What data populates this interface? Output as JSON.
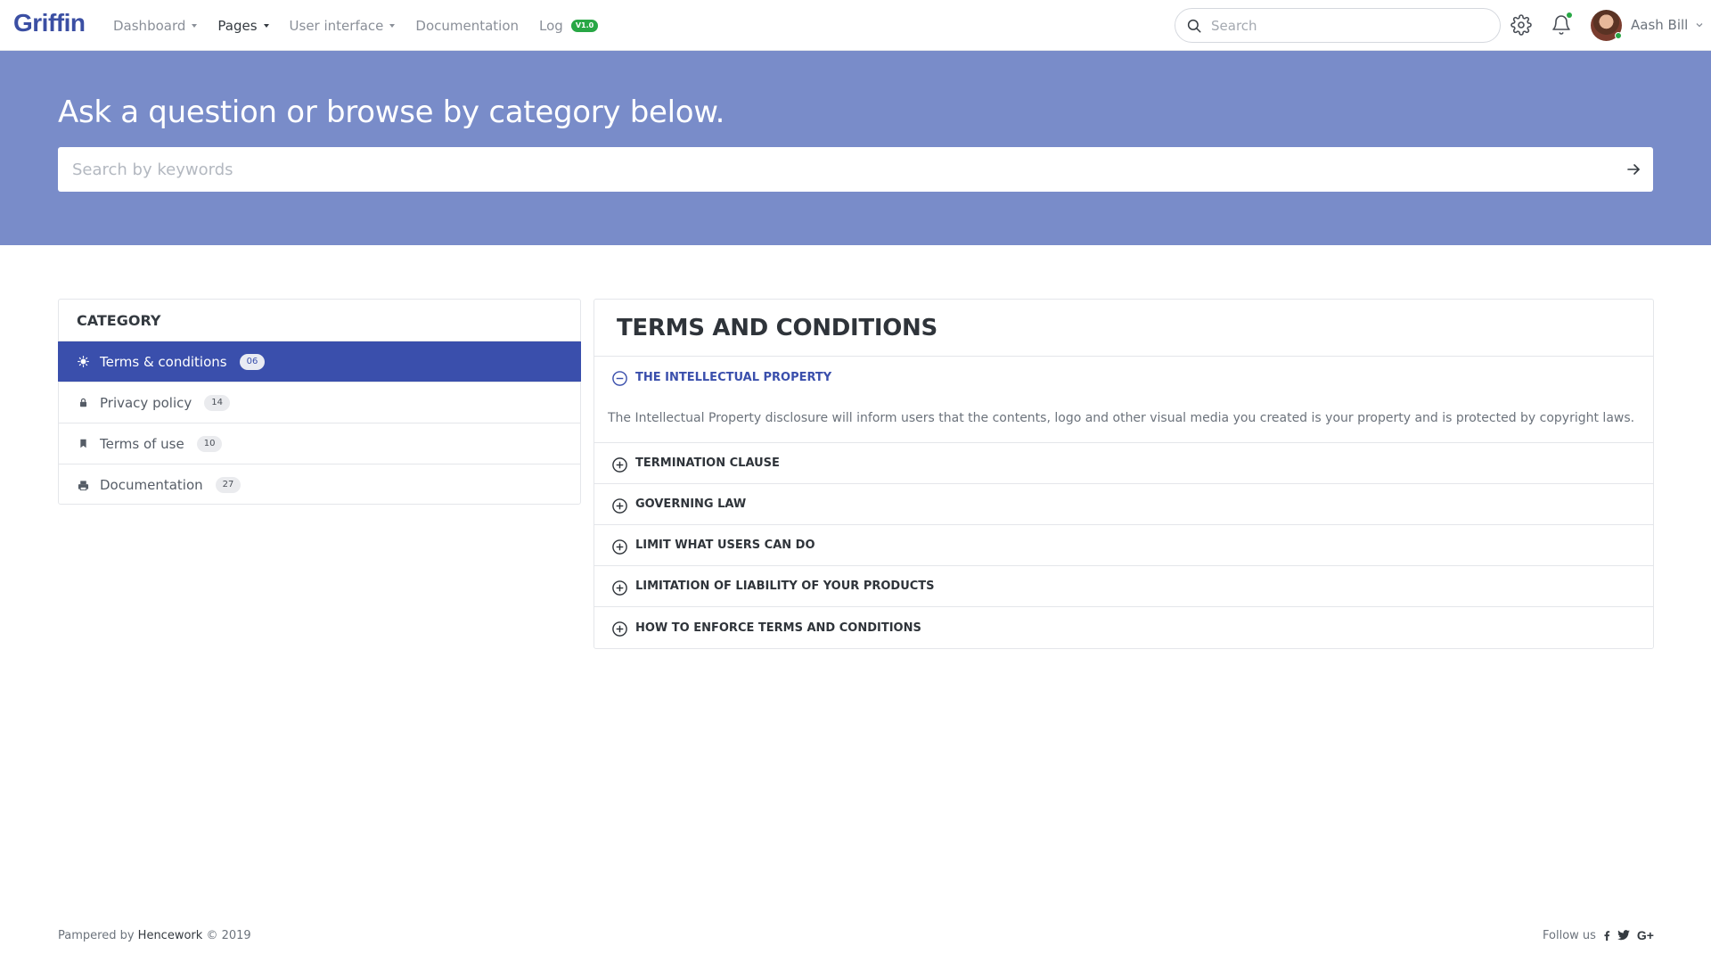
{
  "nav": {
    "brand": "Griffin",
    "items": [
      {
        "label": "Dashboard",
        "has_caret": true
      },
      {
        "label": "Pages",
        "has_caret": true
      },
      {
        "label": "User interface",
        "has_caret": true
      },
      {
        "label": "Documentation",
        "has_caret": false
      },
      {
        "label": "Log",
        "has_caret": false
      }
    ],
    "log_badge": "V1.0",
    "search_placeholder": "Search",
    "user_name": "Aash Bill"
  },
  "hero": {
    "title": "Ask a question or browse by category below.",
    "search_placeholder": "Search by keywords"
  },
  "category": {
    "heading": "CATEGORY",
    "items": [
      {
        "label": "Terms & conditions",
        "count": "06",
        "icon": "sun-icon",
        "active": true
      },
      {
        "label": "Privacy policy",
        "count": "14",
        "icon": "lock-icon",
        "active": false
      },
      {
        "label": "Terms of use",
        "count": "10",
        "icon": "bookmark-icon",
        "active": false
      },
      {
        "label": "Documentation",
        "count": "27",
        "icon": "printer-icon",
        "active": false
      }
    ]
  },
  "terms": {
    "title": "TERMS AND CONDITIONS",
    "open_item": {
      "title": "THE INTELLECTUAL PROPERTY",
      "body": "The Intellectual Property disclosure will inform users that the contents, logo and other visual media you created is your property and is protected by copyright laws."
    },
    "items": [
      "TERMINATION CLAUSE",
      "GOVERNING LAW",
      "LIMIT WHAT USERS CAN DO",
      "LIMITATION OF LIABILITY OF YOUR PRODUCTS",
      "HOW TO ENFORCE TERMS AND CONDITIONS"
    ]
  },
  "footer": {
    "prefix": "Pampered by",
    "brand": "Hencework",
    "suffix": "© 2019",
    "follow": "Follow us",
    "social": [
      "facebook-icon",
      "twitter-icon",
      "google-plus-icon"
    ]
  },
  "colors": {
    "brand": "#3b4fa3",
    "hero_bg": "#798cc9",
    "active_bg": "#3a4fac",
    "badge_green": "#28a745"
  }
}
